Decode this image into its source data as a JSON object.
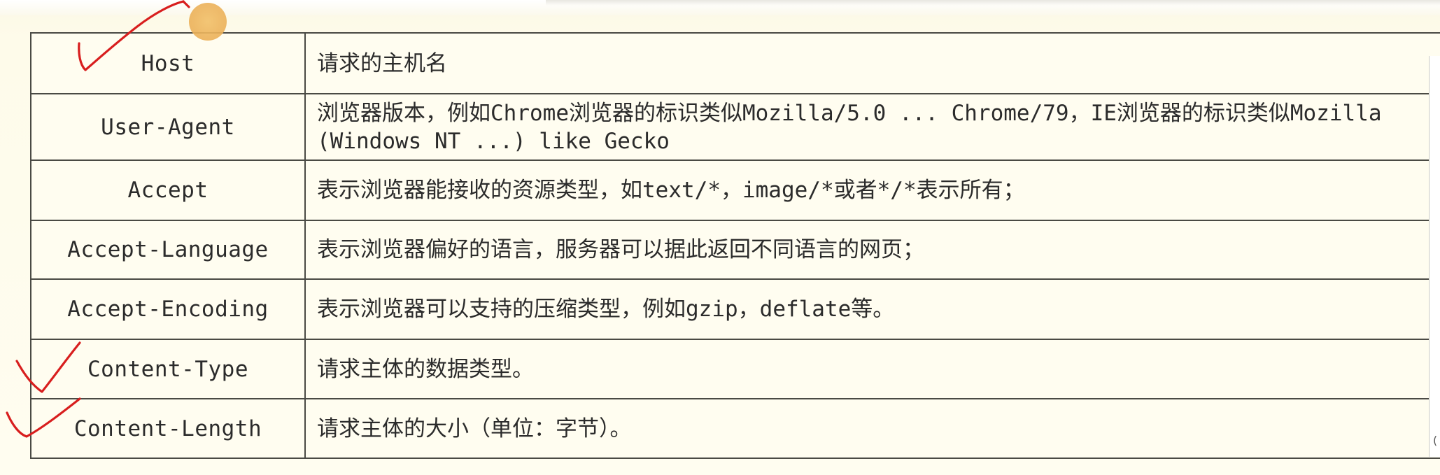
{
  "table": {
    "rows": [
      {
        "name": "Host",
        "desc": [
          "请求的主机名"
        ]
      },
      {
        "name": "User-Agent",
        "desc": [
          "浏览器版本，例如Chrome浏览器的标识类似Mozilla/5.0 ... Chrome/79，IE浏览器的标识类似Mozilla",
          "(Windows NT ...) like Gecko"
        ]
      },
      {
        "name": "Accept",
        "desc": [
          "表示浏览器能接收的资源类型，如text/*，image/*或者*/*表示所有；"
        ]
      },
      {
        "name": "Accept-Language",
        "desc": [
          "表示浏览器偏好的语言，服务器可以据此返回不同语言的网页；"
        ]
      },
      {
        "name": "Accept-Encoding",
        "desc": [
          "表示浏览器可以支持的压缩类型，例如gzip，deflate等。"
        ]
      },
      {
        "name": "Content-Type",
        "desc": [
          "请求主体的数据类型。"
        ]
      },
      {
        "name": "Content-Length",
        "desc": [
          "请求主体的大小（单位：字节）。"
        ]
      }
    ]
  },
  "annotations": {
    "ink_color": "#d81e1e",
    "marks": [
      "checkmark-host",
      "checkmark-content-type",
      "checkmark-content-length"
    ]
  },
  "pointer": {
    "color": "#ecb25a"
  },
  "right_edge_glyph": "("
}
